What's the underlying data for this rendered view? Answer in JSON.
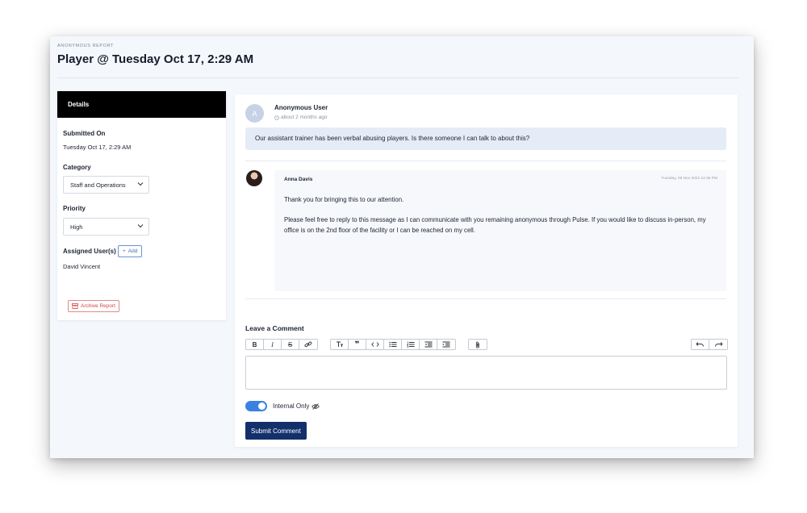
{
  "header": {
    "eyebrow": "ANONYMOUS REPORT",
    "title": "Player @ Tuesday Oct 17, 2:29 AM"
  },
  "details": {
    "tab_label": "Details",
    "submitted_label": "Submitted On",
    "submitted_value": "Tuesday Oct 17, 2:29 AM",
    "category_label": "Category",
    "category_value": "Staff and Operations",
    "priority_label": "Priority",
    "priority_value": "High",
    "assigned_label": "Assigned User(s)",
    "add_label": "Add",
    "assigned_user": "David Vincent",
    "archive_label": "Archive Report"
  },
  "thread": {
    "message": {
      "avatar_initial": "A",
      "author": "Anonymous User",
      "time_ago": "about 2 months ago",
      "text": "Our assistant trainer has been verbal abusing players. Is there someone I can talk to about this?"
    },
    "reply": {
      "author": "Anna Davis",
      "date": "Tuesday, 08 Nov 2022 12:35 PM",
      "paragraph1": "Thank you for bringing this to our attention.",
      "paragraph2": "Please feel free to reply to this message as I can communicate with you remaining anonymous through Pulse.  If you would like to discuss in-person, my office is on the 2nd floor of the facility or I can be reached on my cell."
    }
  },
  "comment": {
    "title": "Leave a Comment",
    "internal_only_label": "Internal Only",
    "internal_only_enabled": true,
    "submit_label": "Submit Comment"
  },
  "colors": {
    "accent": "#3b82e0",
    "submit": "#13306b",
    "archive": "#d24545",
    "bubble": "#e5ecf8"
  }
}
